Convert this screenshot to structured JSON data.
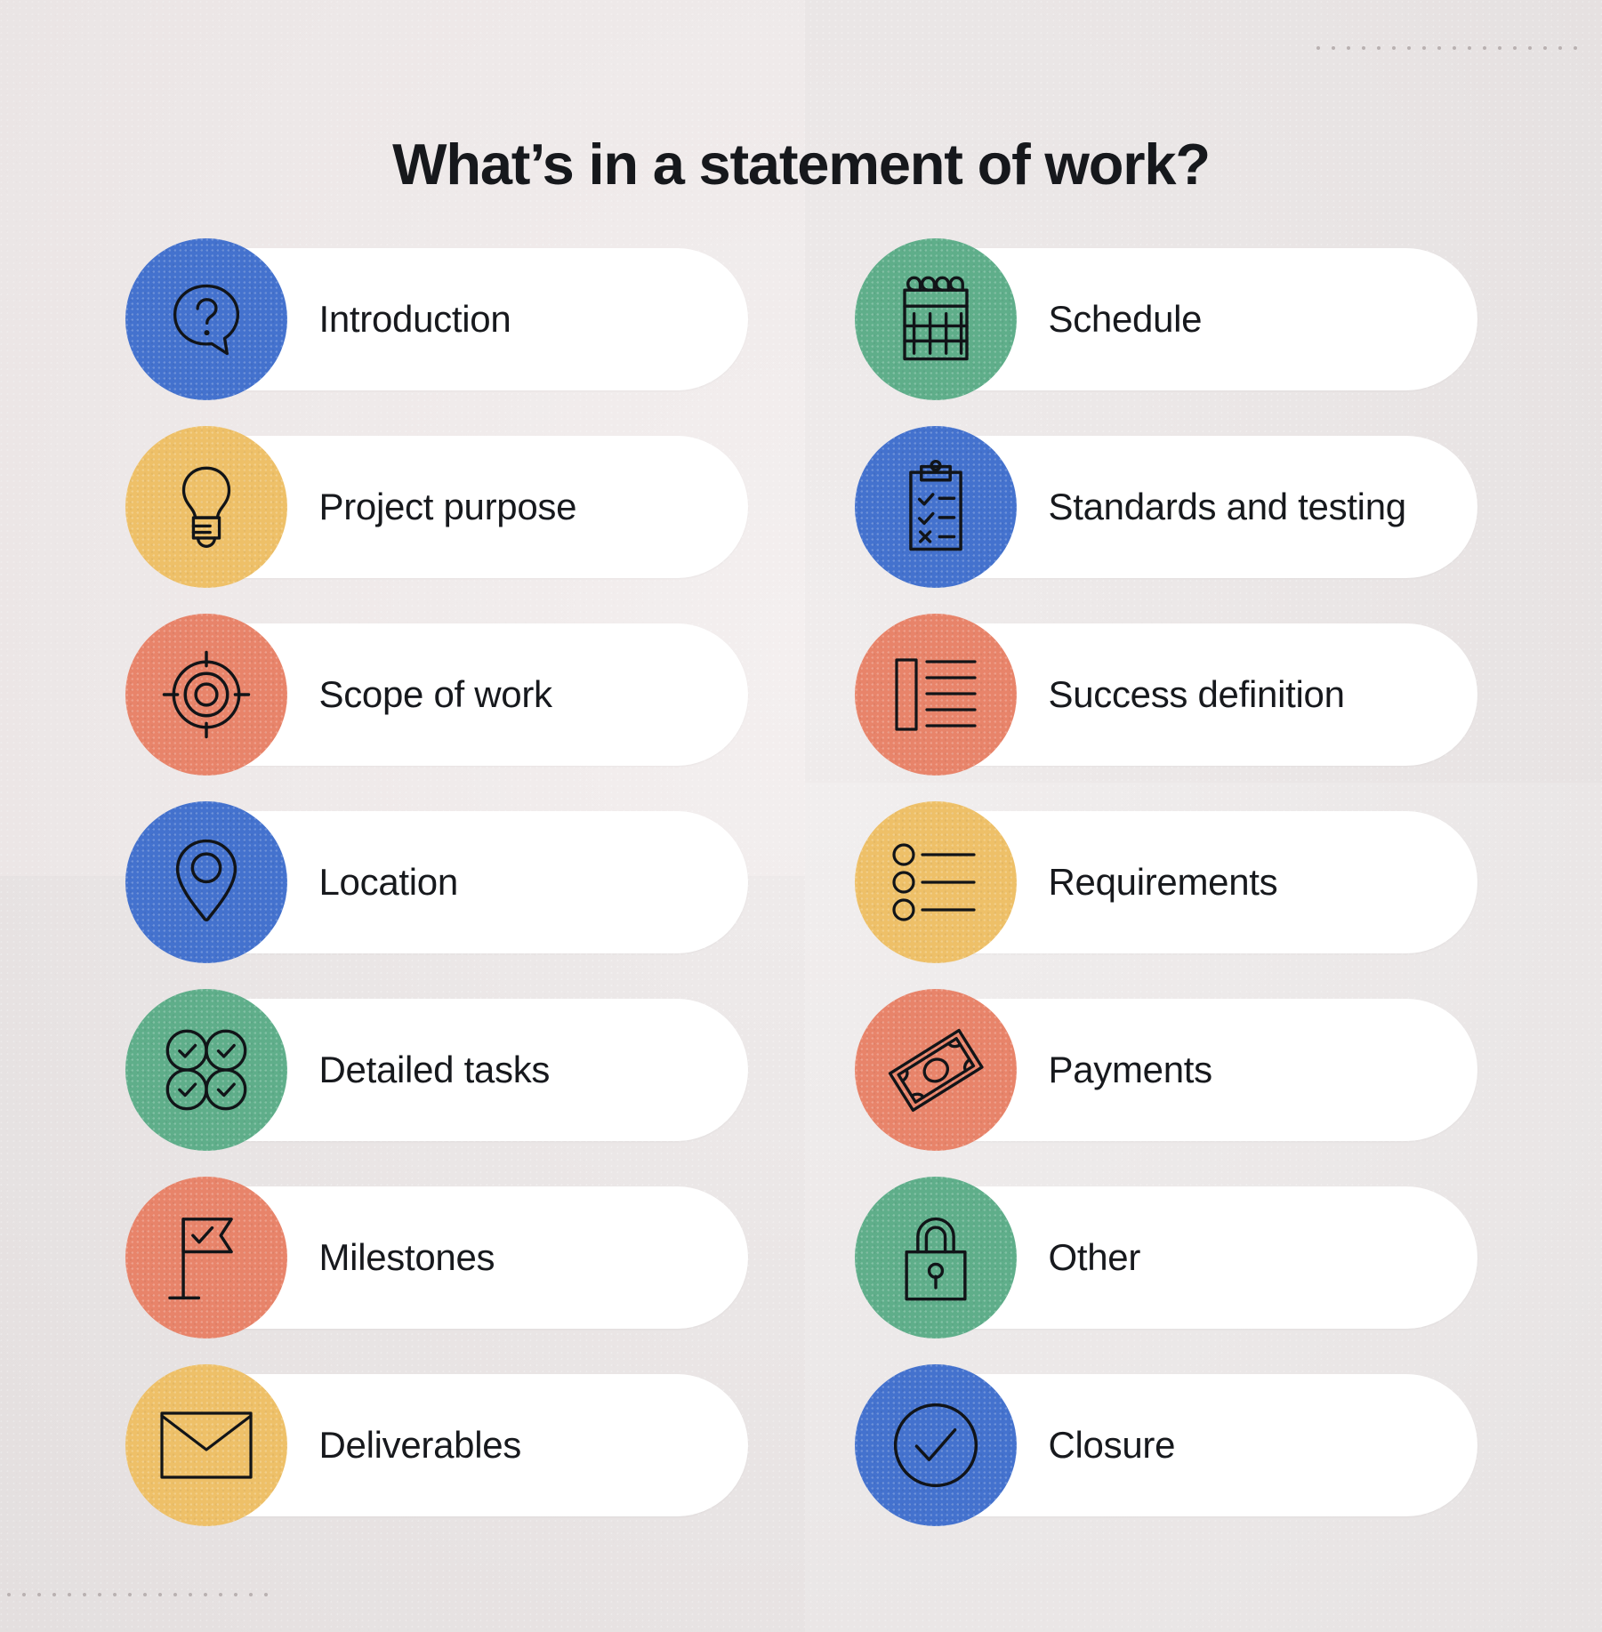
{
  "page": {
    "title": "What’s in a statement of work?",
    "background_color": "#ece7e7",
    "card_color": "#ffffff",
    "text_color": "#17191d"
  },
  "palette": {
    "blue": "#4472CE",
    "yellow": "#EEC068",
    "coral": "#E8846A",
    "green": "#5FAE8A"
  },
  "decorations": {
    "dot_color": "#b9b1b1",
    "top_right_dots": 18,
    "bottom_left_dots": 18
  },
  "columns": {
    "left": [
      {
        "label": "Introduction",
        "icon": "question-speech-bubble-icon",
        "color": "#4472CE"
      },
      {
        "label": "Project purpose",
        "icon": "lightbulb-icon",
        "color": "#EEC068"
      },
      {
        "label": "Scope of work",
        "icon": "target-icon",
        "color": "#E8846A"
      },
      {
        "label": "Location",
        "icon": "map-pin-icon",
        "color": "#4472CE"
      },
      {
        "label": "Detailed tasks",
        "icon": "four-checks-icon",
        "color": "#5FAE8A"
      },
      {
        "label": "Milestones",
        "icon": "flag-check-icon",
        "color": "#E8846A"
      },
      {
        "label": "Deliverables",
        "icon": "envelope-icon",
        "color": "#EEC068"
      }
    ],
    "right": [
      {
        "label": "Schedule",
        "icon": "calendar-icon",
        "color": "#5FAE8A"
      },
      {
        "label": "Standards and testing",
        "icon": "clipboard-check-icon",
        "color": "#4472CE"
      },
      {
        "label": "Success definition",
        "icon": "article-lines-icon",
        "color": "#E8846A"
      },
      {
        "label": "Requirements",
        "icon": "bullet-list-icon",
        "color": "#EEC068"
      },
      {
        "label": "Payments",
        "icon": "banknote-icon",
        "color": "#E8846A"
      },
      {
        "label": "Other",
        "icon": "padlock-icon",
        "color": "#5FAE8A"
      },
      {
        "label": "Closure",
        "icon": "check-circle-icon",
        "color": "#4472CE"
      }
    ]
  }
}
